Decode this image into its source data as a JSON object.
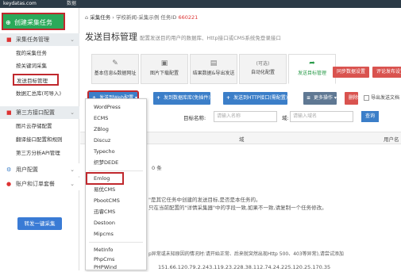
{
  "topbar": {
    "brand": "keydatas.com",
    "title": "数据"
  },
  "sidebar": {
    "create_label": "创建采集任务",
    "sections": [
      {
        "label": "采集任务管理"
      },
      {
        "label": "第三方接口配置"
      },
      {
        "label": "用户配置"
      },
      {
        "label": "账户和订单套餐"
      }
    ],
    "items": [
      {
        "label": "我的采集任务"
      },
      {
        "label": "按关键词采集"
      },
      {
        "label": "发送目标管理"
      },
      {
        "label": "数据汇总库(可导入)"
      },
      {
        "label": "图片云存储配置"
      },
      {
        "label": "翻译接口配置和规则"
      },
      {
        "label": "第三方分析API管理"
      }
    ],
    "share_label": "转发一键采集"
  },
  "main": {
    "breadcrumb_home": "采集任务",
    "breadcrumb_task": "学校新闻-采集示例",
    "breadcrumb_id_label": "任务ID",
    "breadcrumb_id": "660221",
    "title": "发送目标管理",
    "subtitle": "配置发送目的用户的数据库、Http接口或CMS系统免登录接口",
    "tabs": [
      {
        "label": "基本信息&数据网址",
        "icon": "✎"
      },
      {
        "label": "图片下载配置",
        "icon": "▣"
      },
      {
        "label": "结果数据&导出发送",
        "icon": "▤"
      },
      {
        "label": "自动化配置",
        "icon": "(可选)"
      },
      {
        "label": "发送目标管理",
        "icon": "➦"
      }
    ],
    "red_buttons": [
      "同步数据设置",
      "评论发布设置"
    ],
    "toolbar": {
      "web_label": "发送到Web配置",
      "db_label": "发到数据库库(免插件)",
      "http_label": "发送到HTTP接口(需配置)",
      "more_label": "更多操作",
      "delete_label": "删除",
      "export_label": "导出发送文档"
    },
    "search": {
      "target_label": "目标名称:",
      "target_placeholder": "请输入名称",
      "domain_label": "域:",
      "domain_placeholder": "请输入域名",
      "search_label": "查询"
    },
    "table_headers": [
      "域",
      "用户名"
    ],
    "empty_text": "0 条",
    "note1": "\"是其它任务中创建的发送目标,是否是本任务的。",
    "note2": "只在当前配置的\"详情采集器\"中的字段一致,如果不一致,请复制一个任务修改。",
    "ip_label": "p异常或未知原因的情况时:请开始正常、后来就突然出现Http 500、403等异常),请尝试添加",
    "ip_list": "151.66.120.79.2.243.119.23.228.38.112.74.24.225.120.25.170.35"
  },
  "dropdown": {
    "groups": [
      [
        "WordPress",
        "ECMS",
        "ZBlog",
        "Discuz",
        "Typecho",
        "织梦DEDE"
      ],
      [
        "Emlog",
        "易优CMS",
        "PbootCMS",
        "迅睿CMS",
        "Destoon",
        "Mipcms"
      ],
      [
        "MetInfo",
        "PhpCms",
        "PHPWind"
      ]
    ]
  }
}
